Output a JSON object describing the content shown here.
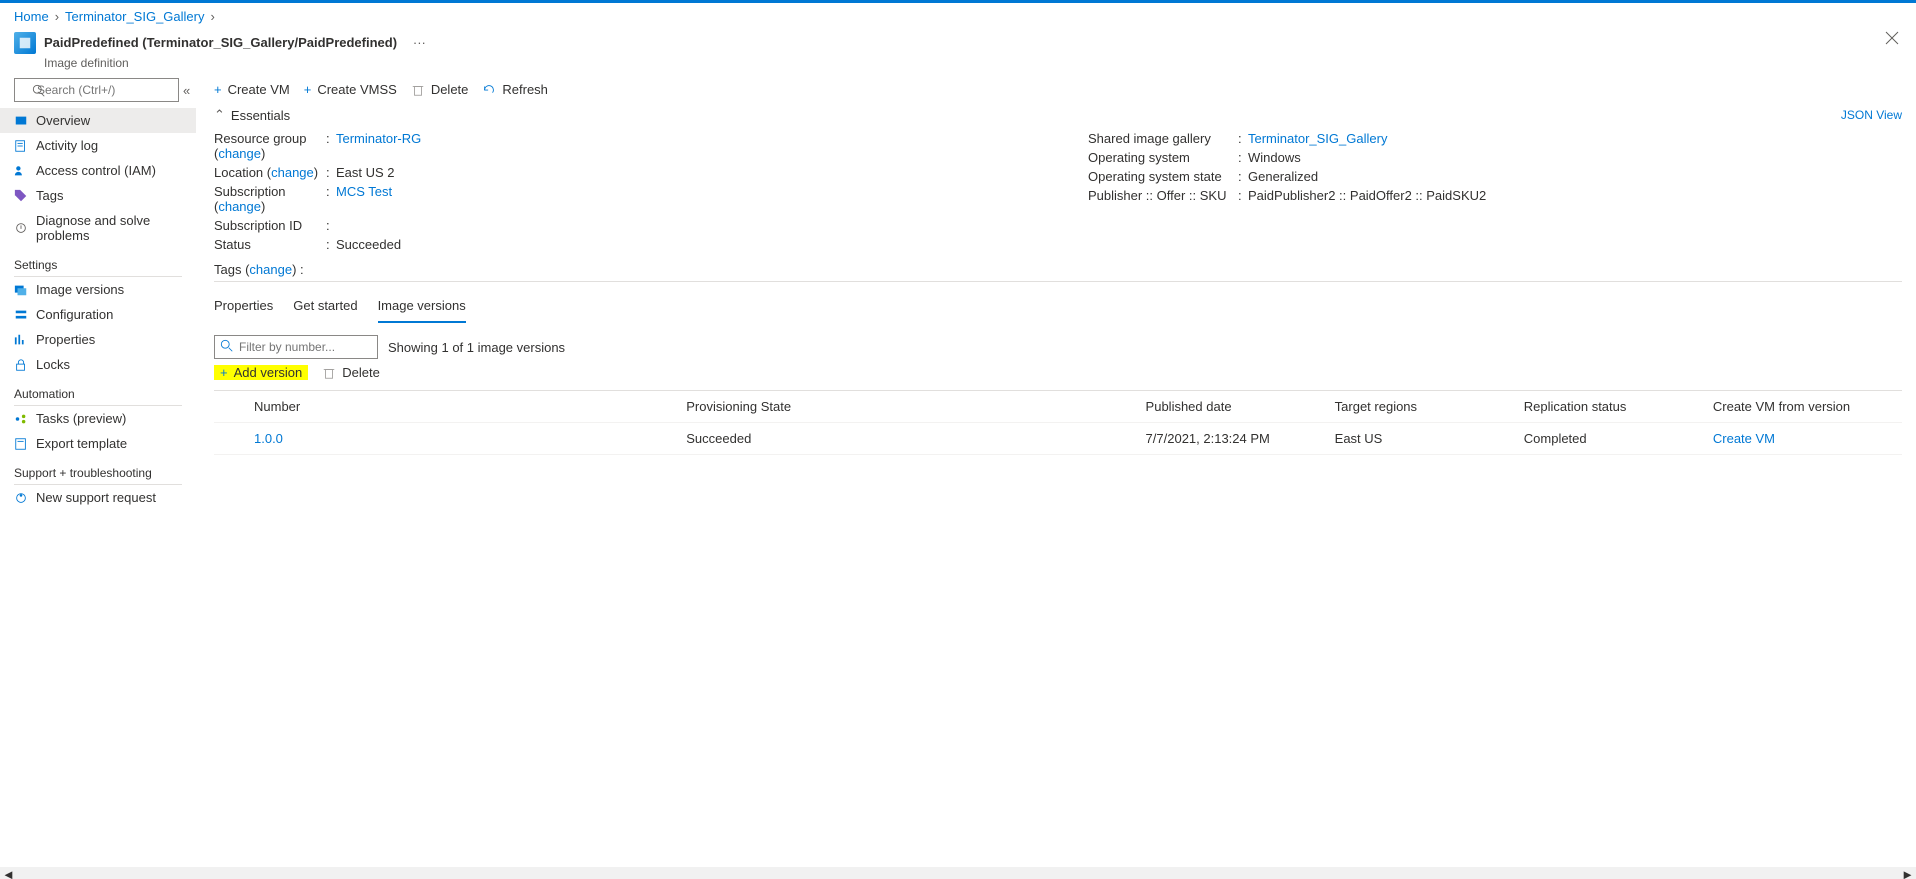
{
  "breadcrumb": {
    "home": "Home",
    "gallery": "Terminator_SIG_Gallery"
  },
  "title": {
    "main": "PaidPredefined (Terminator_SIG_Gallery/PaidPredefined)",
    "sub": "Image definition",
    "more": "···"
  },
  "sidebar": {
    "search_placeholder": "Search (Ctrl+/)",
    "items": {
      "overview": "Overview",
      "activity": "Activity log",
      "iam": "Access control (IAM)",
      "tags": "Tags",
      "diagnose": "Diagnose and solve problems"
    },
    "groups": {
      "settings": "Settings",
      "automation": "Automation",
      "support": "Support + troubleshooting"
    },
    "settings": {
      "image_versions": "Image versions",
      "configuration": "Configuration",
      "properties": "Properties",
      "locks": "Locks"
    },
    "automation": {
      "tasks": "Tasks (preview)",
      "export": "Export template"
    },
    "support": {
      "new_request": "New support request"
    }
  },
  "commands": {
    "create_vm": "Create VM",
    "create_vmss": "Create VMSS",
    "delete": "Delete",
    "refresh": "Refresh"
  },
  "essentials": {
    "header": "Essentials",
    "json_view": "JSON View",
    "left": {
      "rg_label": "Resource group",
      "change": "change",
      "rg_value": "Terminator-RG",
      "loc_label": "Location",
      "loc_value": "East US 2",
      "sub_label": "Subscription",
      "sub_value": "MCS Test",
      "subid_label": "Subscription ID",
      "subid_value": "",
      "status_label": "Status",
      "status_value": "Succeeded"
    },
    "right": {
      "sig_label": "Shared image gallery",
      "sig_value": "Terminator_SIG_Gallery",
      "os_label": "Operating system",
      "os_value": "Windows",
      "osstate_label": "Operating system state",
      "osstate_value": "Generalized",
      "plan_label": "Publisher :: Offer :: SKU",
      "plan_value": "PaidPublisher2 :: PaidOffer2 :: PaidSKU2"
    },
    "tags_label": "Tags"
  },
  "tabs": {
    "properties": "Properties",
    "get_started": "Get started",
    "image_versions": "Image versions"
  },
  "versions": {
    "filter_placeholder": "Filter by number...",
    "count_text": "Showing 1 of 1 image versions",
    "add_version": "Add version",
    "delete": "Delete",
    "columns": {
      "number": "Number",
      "provisioning": "Provisioning State",
      "published": "Published date",
      "regions": "Target regions",
      "replication": "Replication status",
      "create_vm": "Create VM from version"
    },
    "rows": [
      {
        "number": "1.0.0",
        "provisioning": "Succeeded",
        "published": "7/7/2021, 2:13:24 PM",
        "regions": "East US",
        "replication": "Completed",
        "create_vm": "Create VM"
      }
    ]
  }
}
